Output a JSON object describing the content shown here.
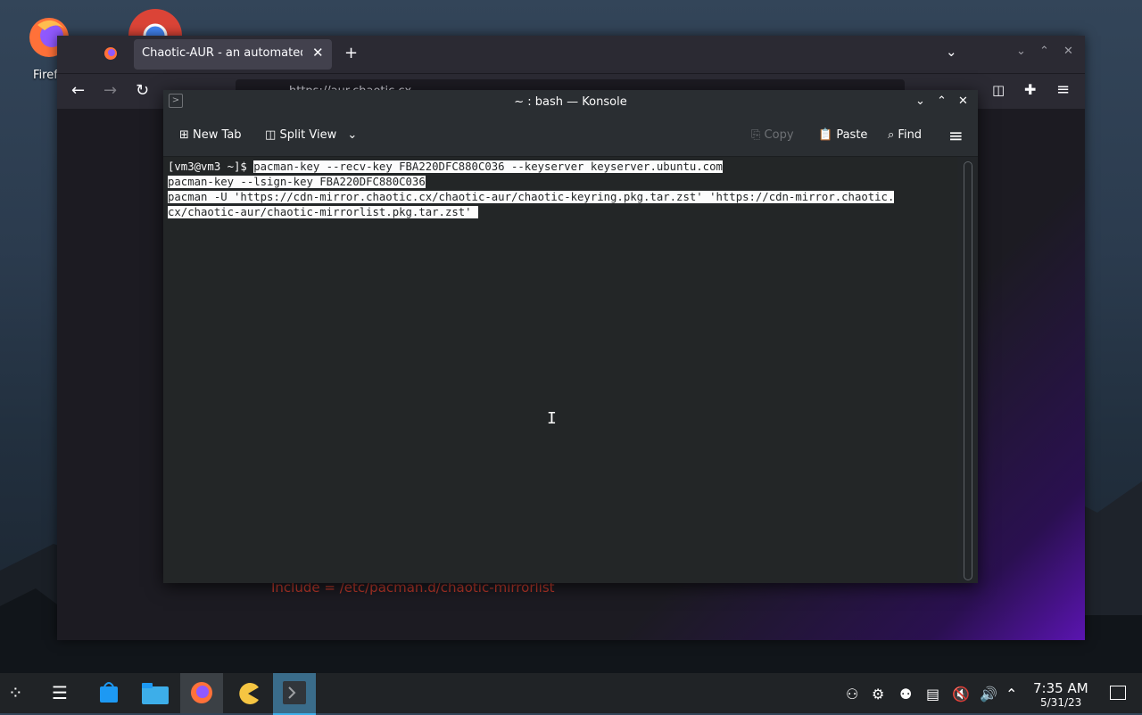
{
  "desktop": {
    "firefox_label": "Firef"
  },
  "firefox": {
    "tab_title": "Chaotic-AUR - an automated b",
    "url": "https://aur.chaotic.cx",
    "page_text": "Include = /etc/pacman.d/chaotic-mirrorlist"
  },
  "konsole": {
    "title": "~ : bash — Konsole",
    "toolbar": {
      "new_tab": "New Tab",
      "split_view": "Split View",
      "copy": "Copy",
      "paste": "Paste",
      "find": "Find"
    },
    "terminal": {
      "prompt": "[vm3@vm3 ~]$ ",
      "line1": "pacman-key --recv-key FBA220DFC880C036 --keyserver keyserver.ubuntu.com",
      "line2": "pacman-key --lsign-key FBA220DFC880C036",
      "line3": "pacman -U 'https://cdn-mirror.chaotic.cx/chaotic-aur/chaotic-keyring.pkg.tar.zst' 'https://cdn-mirror.chaotic.",
      "line4": "cx/chaotic-aur/chaotic-mirrorlist.pkg.tar.zst'"
    }
  },
  "taskbar": {
    "time": "7:35 AM",
    "date": "5/31/23"
  },
  "colors": {
    "accent": "#3daee9",
    "konsole_bg": "#232627",
    "firefox_bg": "#1c1b22"
  }
}
